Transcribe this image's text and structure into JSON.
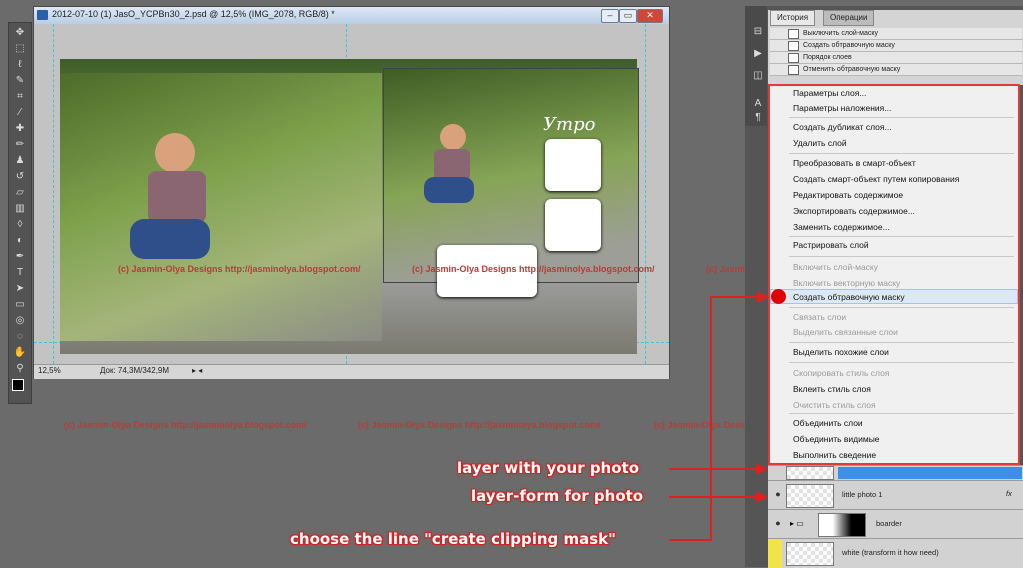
{
  "document": {
    "title": "2012-07-10 (1) JasO_YCPBn30_2.psd @ 12,5% (IMG_2078, RGB/8) *",
    "zoom": "12,5%",
    "doc_info": "Док: 74,3М/342,9М",
    "page_title_script": "Утро"
  },
  "history": {
    "tabs": [
      "История",
      "Операции"
    ],
    "items": [
      "Выключить слой-маску",
      "Создать обтравочную маску",
      "Порядок слоев",
      "Отменить обтравочную маску"
    ]
  },
  "context_menu": {
    "items": [
      {
        "label": "Параметры слоя...",
        "disabled": false
      },
      {
        "label": "Параметры наложения...",
        "disabled": false
      },
      {
        "label": "Создать дубликат слоя...",
        "disabled": false
      },
      {
        "label": "Удалить слой",
        "disabled": false
      },
      {
        "label": "Преобразовать в смарт-объект",
        "disabled": false
      },
      {
        "label": "Создать смарт-объект путем копирования",
        "disabled": false
      },
      {
        "label": "Редактировать содержимое",
        "disabled": false
      },
      {
        "label": "Экспортировать содержимое...",
        "disabled": false
      },
      {
        "label": "Заменить содержимое...",
        "disabled": false
      },
      {
        "label": "Растрировать слой",
        "disabled": false
      },
      {
        "label": "Включить слой-маску",
        "disabled": true
      },
      {
        "label": "Включить векторную маску",
        "disabled": true
      },
      {
        "label": "Создать обтравочную маску",
        "disabled": false
      },
      {
        "label": "Связать слои",
        "disabled": true
      },
      {
        "label": "Выделить связанные слои",
        "disabled": true
      },
      {
        "label": "Выделить похожие слои",
        "disabled": false
      },
      {
        "label": "Скопировать стиль слоя",
        "disabled": true
      },
      {
        "label": "Вклеить стиль слоя",
        "disabled": false
      },
      {
        "label": "Очистить стиль слоя",
        "disabled": true
      },
      {
        "label": "Объединить слои",
        "disabled": false
      },
      {
        "label": "Объединить видимые",
        "disabled": false
      },
      {
        "label": "Выполнить сведение",
        "disabled": false
      }
    ]
  },
  "layers": {
    "rows": [
      {
        "name": ""
      },
      {
        "name": "little photo 1",
        "fx": "fx"
      },
      {
        "name": "boarder"
      },
      {
        "name": "white (transform it how need)"
      }
    ]
  },
  "annotations": {
    "callout1": "layer with your photo",
    "callout2": "layer-form for photo",
    "callout3": "choose the line \"create clipping mask\""
  },
  "watermark": "(c) Jasmin-Olya Designs http://jasminolya.blogspot.com/",
  "colors": {
    "annotation_red": "#e01f1f",
    "menu_border": "#e03a3a",
    "selection_blue": "#3b8fe8"
  }
}
